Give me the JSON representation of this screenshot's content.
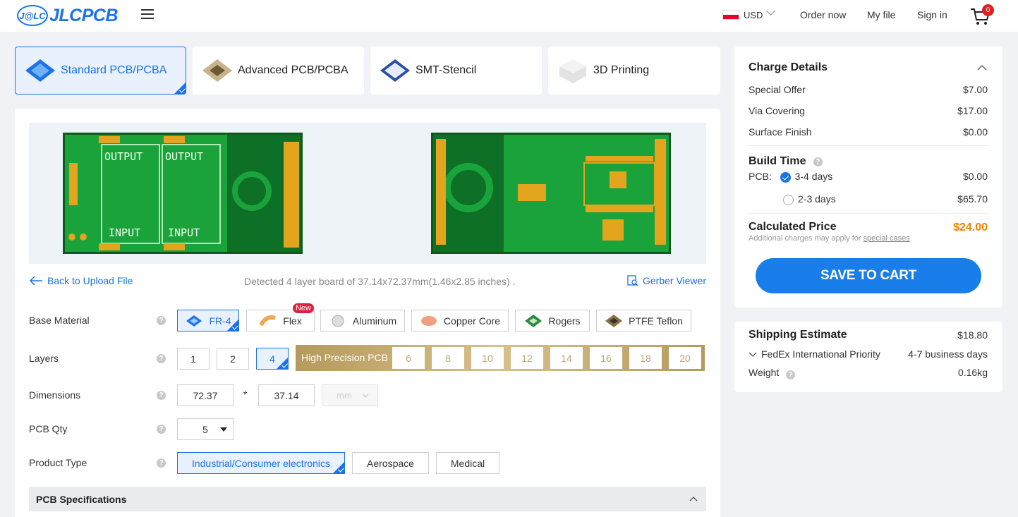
{
  "header": {
    "logo_badge": "J@LC",
    "logo_text": "JLCPCB",
    "currency": "USD",
    "nav": [
      "Order now",
      "My file",
      "Sign in"
    ],
    "cart_count": "0"
  },
  "product_tabs": [
    {
      "label": "Standard PCB/PCBA",
      "active": true
    },
    {
      "label": "Advanced PCB/PCBA",
      "active": false
    },
    {
      "label": "SMT-Stencil",
      "active": false
    },
    {
      "label": "3D Printing",
      "active": false
    }
  ],
  "board": {
    "back_link": "Back to Upload File",
    "detected": "Detected 4 layer board of 37.14x72.37mm(1.46x2.85 inches) .",
    "gerber_viewer": "Gerber Viewer",
    "silk_top": [
      "OUTPUT",
      "OUTPUT",
      "INPUT",
      "INPUT"
    ]
  },
  "form": {
    "base_material": {
      "label": "Base Material",
      "options": [
        "FR-4",
        "Flex",
        "Aluminum",
        "Copper Core",
        "Rogers",
        "PTFE Teflon"
      ],
      "selected": "FR-4",
      "new_badge": "New"
    },
    "layers": {
      "label": "Layers",
      "options": [
        "1",
        "2",
        "4"
      ],
      "selected": "4",
      "high_precision_label": "High Precision PCB",
      "high_precision_options": [
        "6",
        "8",
        "10",
        "12",
        "14",
        "16",
        "18",
        "20"
      ]
    },
    "dimensions": {
      "label": "Dimensions",
      "length": "72.37",
      "separator": "*",
      "width": "37.14",
      "unit": "mm"
    },
    "pcb_qty": {
      "label": "PCB Qty",
      "value": "5"
    },
    "product_type": {
      "label": "Product Type",
      "options": [
        "Industrial/Consumer electronics",
        "Aerospace",
        "Medical"
      ],
      "selected": "Industrial/Consumer electronics"
    },
    "spec_section": "PCB Specifications"
  },
  "charge": {
    "title": "Charge Details",
    "items": [
      {
        "name": "Special Offer",
        "value": "$7.00"
      },
      {
        "name": "Via Covering",
        "value": "$17.00"
      },
      {
        "name": "Surface Finish",
        "value": "$0.00"
      }
    ],
    "build_time": {
      "title": "Build Time",
      "pcb_label": "PCB:",
      "options": [
        {
          "label": "3-4 days",
          "price": "$0.00",
          "selected": true
        },
        {
          "label": "2-3 days",
          "price": "$65.70",
          "selected": false
        }
      ]
    },
    "calculated": {
      "label": "Calculated Price",
      "value": "$24.00",
      "note": "Additional charges may apply for",
      "note_link": "special cases"
    },
    "save_button": "SAVE TO CART"
  },
  "shipping": {
    "title": "Shipping Estimate",
    "price": "$18.80",
    "carrier": "FedEx International Priority",
    "days": "4-7 business days",
    "weight_label": "Weight",
    "weight_value": "0.16kg"
  },
  "colors": {
    "accent": "#1a73e8",
    "price_orange": "#f08300",
    "badge_red": "#e02020"
  }
}
